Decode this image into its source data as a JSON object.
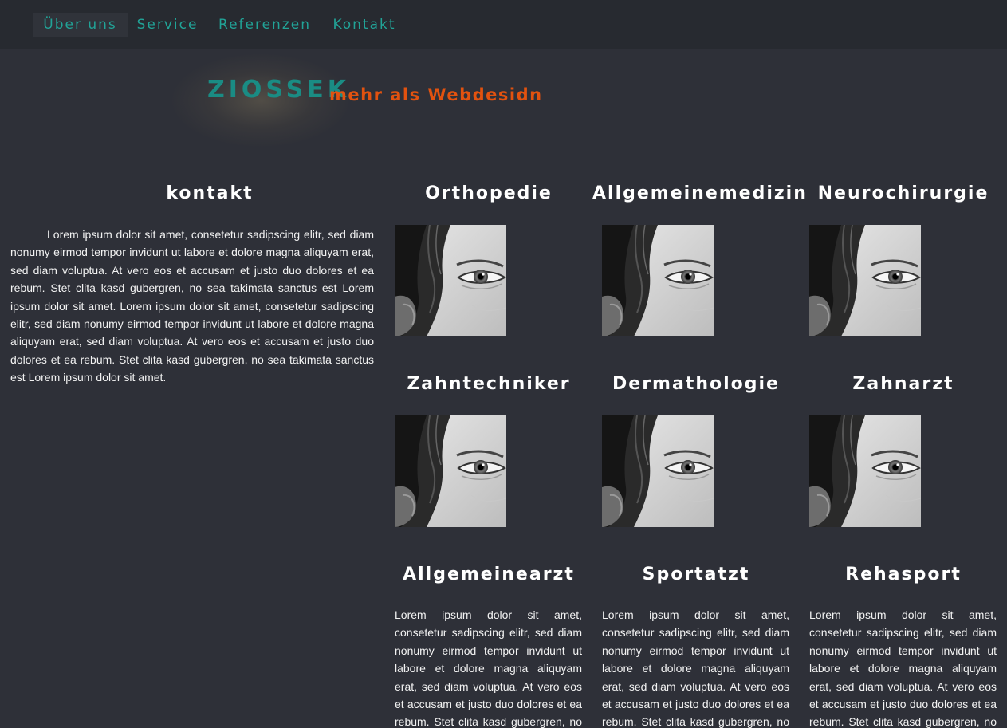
{
  "nav": {
    "items": [
      {
        "label": "Über uns",
        "active": true
      },
      {
        "label": "Service"
      },
      {
        "label": "Referenzen"
      },
      {
        "label": "Kontakt"
      }
    ]
  },
  "brand": {
    "name": "ZIOSSEK",
    "tagline": "mehr als Webdesidn"
  },
  "contact": {
    "title": "kontakt",
    "text": "Lorem ipsum dolor sit amet, consetetur sadipscing elitr, sed diam nonumy eirmod tempor invidunt ut labore et dolore magna aliquyam erat, sed diam voluptua. At vero eos et accusam et justo duo dolores et ea rebum. Stet clita kasd gubergren, no sea takimata sanctus est Lorem ipsum dolor sit amet. Lorem ipsum dolor sit amet, consetetur sadipscing elitr, sed diam nonumy eirmod tempor invidunt ut labore et dolore magna aliquyam erat, sed diam voluptua. At vero eos et accusam et justo duo dolores et ea rebum. Stet clita kasd gubergren, no sea takimata sanctus est Lorem ipsum dolor sit amet."
  },
  "cards": [
    {
      "title": "Orthopedie"
    },
    {
      "title": "Allgemeinemedizin"
    },
    {
      "title": "Neurochirurgie"
    },
    {
      "title": "Zahntechniker"
    },
    {
      "title": "Dermathologie"
    },
    {
      "title": "Zahnarzt"
    }
  ],
  "text_cards": [
    {
      "title": "Allgemeinearzt",
      "text": "Lorem ipsum dolor sit amet, consetetur sadipscing elitr, sed diam nonumy eirmod tempor invidunt ut labore et dolore magna aliquyam erat, sed diam voluptua. At vero eos et accusam et justo duo dolores et ea rebum. Stet clita kasd gubergren, no sea takimata sanctus est"
    },
    {
      "title": "Sportatzt",
      "text": "Lorem ipsum dolor sit amet, consetetur sadipscing elitr, sed diam nonumy eirmod tempor invidunt ut labore et dolore magna aliquyam erat, sed diam voluptua. At vero eos et accusam et justo duo dolores et ea rebum. Stet clita kasd gubergren, no sea takimata sanctus est"
    },
    {
      "title": "Rehasport",
      "text": "Lorem ipsum dolor sit amet, consetetur sadipscing elitr, sed diam nonumy eirmod tempor invidunt ut labore et dolore magna aliquyam erat, sed diam voluptua. At vero eos et accusam et justo duo dolores et ea rebum. Stet clita kasd gubergren, no sea takimata sanctus est"
    }
  ],
  "colors": {
    "background": "#2e3038",
    "nav_background": "#272a30",
    "nav_link": "#21a397",
    "brand_name": "#1a8c84",
    "brand_tagline": "#e2520f"
  }
}
